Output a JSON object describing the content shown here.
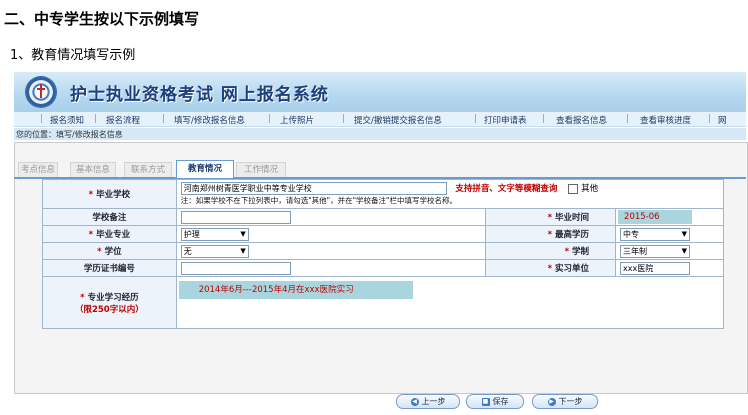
{
  "doc": {
    "heading": "二、中专学生按以下示例填写",
    "subheading": "1、教育情况填写示例"
  },
  "site": {
    "title": "护士执业资格考试  网上报名系统"
  },
  "nav": [
    "报名须知",
    "报名流程",
    "填写/修改报名信息",
    "上传照片",
    "提交/撤销提交报名信息",
    "打印申请表",
    "查看报名信息",
    "查看审核进度",
    "网"
  ],
  "breadcrumb": "您的位置：填写/修改报名信息",
  "tabs": [
    "考点信息",
    "基本信息",
    "联系方式",
    "教育情况",
    "工作情况"
  ],
  "active_tab": "教育情况",
  "form": {
    "school_label": "毕业学校",
    "school_value": "河南郑州树青医学职业中等专业学校",
    "school_hint": "支持拼音、文字等模糊查询",
    "other_label": "其他",
    "school_note": "注：如果学校不在下拉列表中，请勾选\"其他\"，并在\"学校备注\"栏中填写学校名称。",
    "school_remark_label": "学校备注",
    "school_remark_value": "",
    "grad_time_label": "毕业时间",
    "grad_time_value": "2015-06",
    "major_label": "毕业专业",
    "major_value": "护理",
    "degree_level_label": "最高学历",
    "degree_level_value": "中专",
    "degree_label": "学位",
    "degree_value": "无",
    "length_label": "学制",
    "length_value": "三年制",
    "cert_no_label": "学历证书编号",
    "cert_no_value": "",
    "internship_label": "实习单位",
    "internship_value": "xxx医院",
    "experience_label": "专业学习经历",
    "experience_limit": "（限250字以内）",
    "experience_value": "2014年6月---2015年4月在xxx医院实习"
  },
  "buttons": {
    "prev": "上一步",
    "save": "保存",
    "next": "下一步"
  }
}
